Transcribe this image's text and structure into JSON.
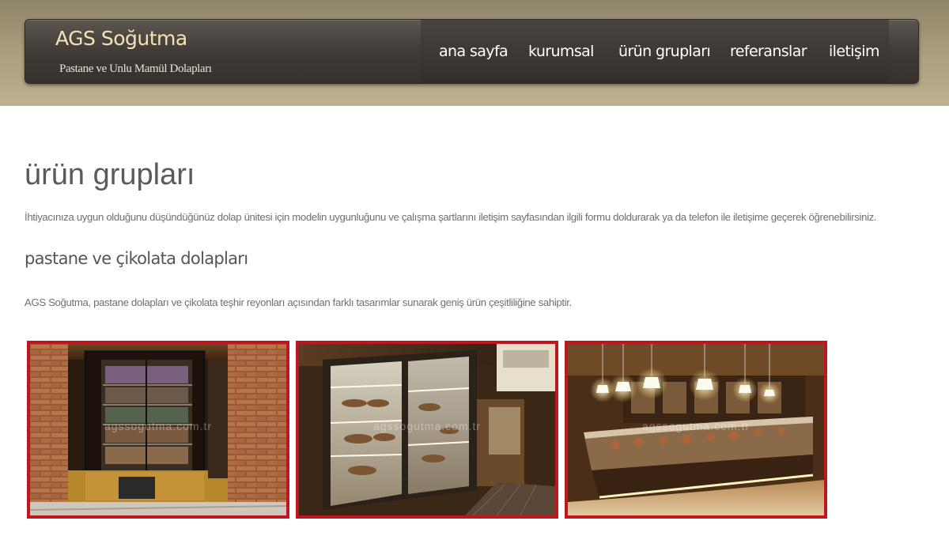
{
  "header": {
    "brand_name": "AGS Soğutma",
    "tagline": "Pastane ve Unlu Mamül Dolapları"
  },
  "nav": {
    "items": [
      {
        "label": "ana sayfa"
      },
      {
        "label": "kurumsal"
      },
      {
        "label": "ürün grupları"
      },
      {
        "label": "referanslar"
      },
      {
        "label": "iletişim"
      }
    ]
  },
  "main": {
    "title": "ürün grupları",
    "intro": "İhtiyacınıza uygun olduğunu düşündüğünüz dolap ünitesi için modelin uygunluğunu ve çalışma şartlarını iletişim sayfasından ilgili formu doldurarak ya da telefon ile iletişime geçerek öğrenebilirsiniz.",
    "section": {
      "heading": "pastane ve çikolata dolapları",
      "text": "AGS Soğutma, pastane dolapları ve çikolata teşhir reyonları açısından farklı tasarımlar sunarak geniş ürün çeşitliliğine sahiptir."
    },
    "gallery": {
      "watermark": "agssogutma.com.tr",
      "border_color": "#c0161f"
    }
  },
  "colors": {
    "header_bg": "#3e3935",
    "brand_text": "#f3e3b3",
    "top_band": "#a79c7c"
  }
}
